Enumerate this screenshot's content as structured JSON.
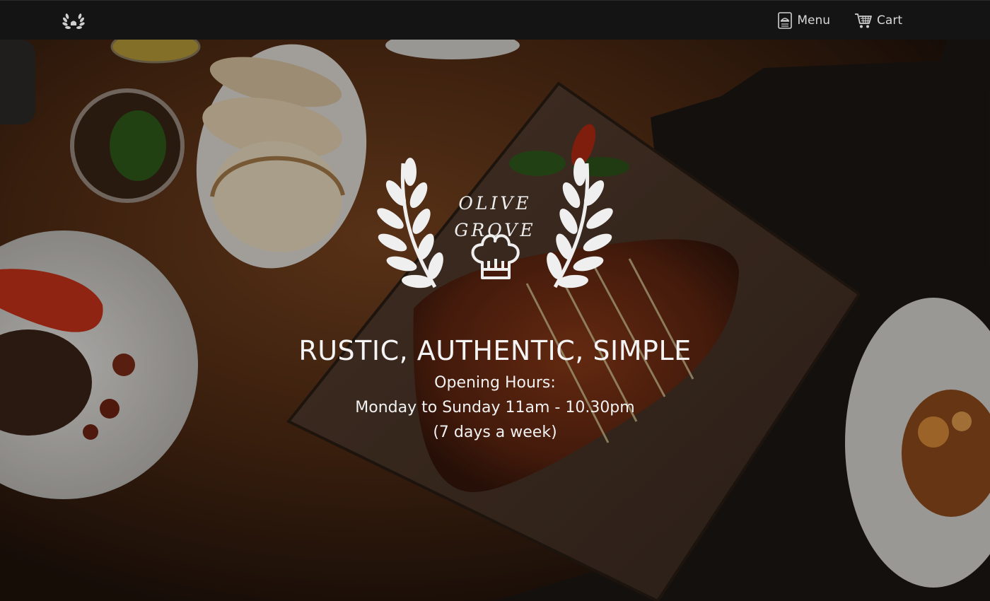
{
  "nav": {
    "menu_label": "Menu",
    "cart_label": "Cart",
    "menu_icon": "menu-book-icon",
    "cart_icon": "shopping-cart-icon",
    "brand_icon": "laurel-wreath-icon"
  },
  "logo": {
    "line1": "OLIVE",
    "line2": "GROVE",
    "icon": "chef-hat-icon"
  },
  "hero": {
    "headline": "RUSTIC, AUTHENTIC, SIMPLE",
    "hours_label": "Opening Hours:",
    "hours_days": "Monday to Sunday 11am - 10.30pm",
    "hours_note": "(7 days a week)"
  },
  "colors": {
    "topbar": "#141414",
    "text": "#f4f4f4",
    "nav_text": "#d7d7d7"
  }
}
